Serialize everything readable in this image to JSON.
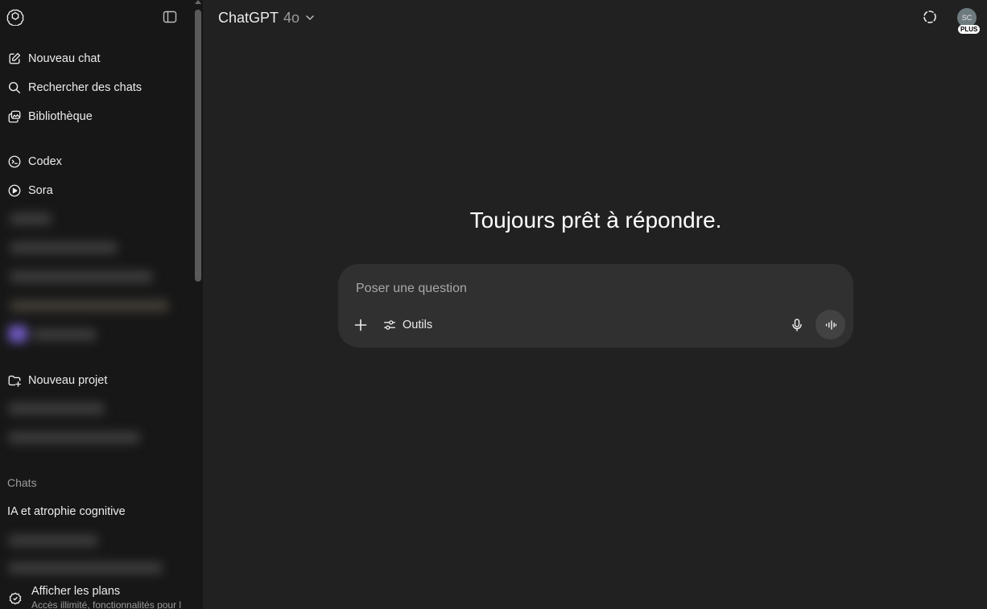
{
  "sidebar": {
    "items": [
      {
        "label": "Nouveau chat",
        "icon": "new-chat-icon"
      },
      {
        "label": "Rechercher des chats",
        "icon": "search-icon"
      },
      {
        "label": "Bibliothèque",
        "icon": "library-icon"
      },
      {
        "label": "Codex",
        "icon": "codex-icon"
      },
      {
        "label": "Sora",
        "icon": "play-circle-icon"
      }
    ],
    "new_project": {
      "label": "Nouveau projet",
      "icon": "folder-plus-icon"
    },
    "chats_section_label": "Chats",
    "chats": [
      "IA et atrophie cognitive"
    ],
    "plans": {
      "title": "Afficher les plans",
      "subtitle": "Accès illimité, fonctionnalités pour l",
      "icon": "plans-icon"
    }
  },
  "header": {
    "model_name": "ChatGPT",
    "model_version": "4o",
    "avatar_initials": "SC",
    "badge": "PLUS"
  },
  "main": {
    "greeting": "Toujours prêt à répondre.",
    "composer": {
      "placeholder": "Poser une question",
      "value": "",
      "tools_label": "Outils"
    }
  },
  "colors": {
    "sidebar_bg": "#171717",
    "main_bg": "#212121",
    "composer_bg": "#303030",
    "text": "#ececec",
    "muted": "#9b9b9b"
  }
}
